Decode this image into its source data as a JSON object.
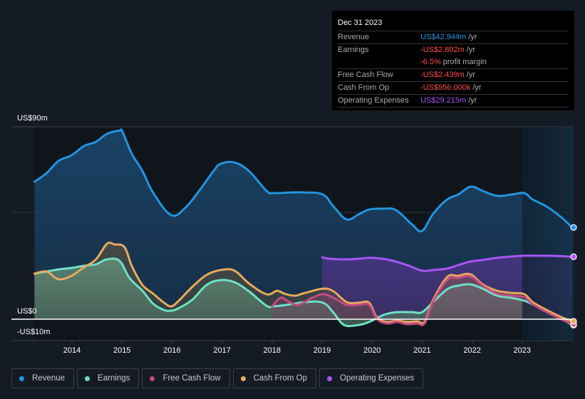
{
  "tooltip": {
    "date": "Dec 31 2023",
    "rows": [
      {
        "label": "Revenue",
        "value": "US$42.944m",
        "unit": "/yr",
        "color": "#2394df"
      },
      {
        "label": "Earnings",
        "value": "-US$2.802m",
        "unit": "/yr",
        "color": "#ff4d4d"
      },
      {
        "label": "",
        "value": "-6.5%",
        "unit": "profit margin",
        "color": "#ff4d4d"
      },
      {
        "label": "Free Cash Flow",
        "value": "-US$2.439m",
        "unit": "/yr",
        "color": "#ff4d4d"
      },
      {
        "label": "Cash From Op",
        "value": "-US$956.000k",
        "unit": "/yr",
        "color": "#ff4d4d"
      },
      {
        "label": "Operating Expenses",
        "value": "US$29.215m",
        "unit": "/yr",
        "color": "#a855f7"
      }
    ]
  },
  "legend": [
    {
      "label": "Revenue",
      "color": "#2394df"
    },
    {
      "label": "Earnings",
      "color": "#6ce0c8"
    },
    {
      "label": "Free Cash Flow",
      "color": "#c74a84"
    },
    {
      "label": "Cash From Op",
      "color": "#e8a95c"
    },
    {
      "label": "Operating Expenses",
      "color": "#a855f7"
    }
  ],
  "chart_data": {
    "type": "area",
    "title": "",
    "xlabel": "",
    "ylabel": "",
    "y_tick_labels": [
      "US$90m",
      "US$0",
      "-US$10m"
    ],
    "ylim": [
      -10,
      90
    ],
    "x_ticks": [
      2014,
      2015,
      2016,
      2017,
      2018,
      2019,
      2020,
      2021,
      2022,
      2023
    ],
    "xlim": [
      2013.25,
      2024.0
    ],
    "forecast_start": 2023.0,
    "grid": true,
    "legend_position": "bottom-left",
    "series": [
      {
        "name": "Revenue",
        "color": "#2394df",
        "x": [
          2013.25,
          2013.49,
          2013.73,
          2013.99,
          2014.24,
          2014.48,
          2014.7,
          2014.95,
          2015.01,
          2015.19,
          2015.41,
          2015.62,
          2015.98,
          2016.26,
          2016.54,
          2016.83,
          2016.97,
          2017.25,
          2017.54,
          2017.89,
          2018.03,
          2018.38,
          2018.66,
          2019.02,
          2019.23,
          2019.49,
          2019.73,
          2019.94,
          2020.23,
          2020.48,
          2020.8,
          2021.0,
          2021.22,
          2021.5,
          2021.72,
          2021.97,
          2022.21,
          2022.5,
          2022.78,
          2023.04,
          2023.21,
          2023.49,
          2023.78,
          2024.0
        ],
        "values": [
          64.3,
          68.3,
          74.0,
          76.7,
          81.0,
          83.0,
          86.7,
          88.3,
          87.7,
          77.7,
          69.3,
          59.3,
          48.7,
          52.0,
          60.0,
          69.3,
          72.7,
          73.3,
          69.3,
          60.0,
          59.0,
          59.3,
          59.3,
          58.3,
          52.7,
          46.7,
          49.0,
          51.3,
          51.7,
          51.0,
          44.3,
          41.3,
          49.3,
          56.0,
          58.3,
          62.0,
          60.0,
          57.7,
          58.3,
          59.0,
          56.0,
          52.7,
          47.7,
          42.9
        ]
      },
      {
        "name": "Earnings",
        "color": "#6ce0c8",
        "x": [
          2013.25,
          2013.49,
          2013.73,
          2013.99,
          2014.24,
          2014.48,
          2014.7,
          2014.95,
          2015.15,
          2015.41,
          2015.62,
          2015.84,
          2015.98,
          2016.12,
          2016.4,
          2016.69,
          2016.97,
          2017.25,
          2017.54,
          2017.89,
          2018.03,
          2018.38,
          2018.66,
          2019.02,
          2019.23,
          2019.44,
          2019.73,
          2019.94,
          2020.23,
          2020.48,
          2020.8,
          2021.0,
          2021.22,
          2021.5,
          2021.72,
          2021.97,
          2022.21,
          2022.5,
          2022.78,
          2023.04,
          2023.21,
          2023.49,
          2023.78,
          2024.0
        ],
        "values": [
          21.3,
          22.3,
          23.3,
          24.0,
          25.0,
          25.7,
          28.0,
          27.3,
          19.3,
          13.3,
          7.3,
          4.3,
          4.0,
          5.0,
          9.0,
          16.0,
          18.3,
          17.3,
          13.0,
          6.3,
          6.0,
          7.0,
          8.0,
          7.7,
          3.0,
          -2.7,
          -2.7,
          -1.3,
          2.0,
          3.3,
          3.3,
          3.3,
          8.0,
          14.0,
          15.7,
          16.3,
          14.3,
          11.0,
          10.0,
          8.7,
          7.0,
          4.0,
          0.3,
          -2.8
        ]
      },
      {
        "name": "Free Cash Flow",
        "color": "#c74a84",
        "x": [
          2018.0,
          2018.17,
          2018.31,
          2018.52,
          2018.8,
          2019.02,
          2019.23,
          2019.49,
          2019.73,
          2019.94,
          2020.1,
          2020.3,
          2020.5,
          2020.7,
          2020.9,
          2021.05,
          2021.22,
          2021.5,
          2021.72,
          2021.97,
          2022.21,
          2022.5,
          2022.78,
          2023.04,
          2023.21,
          2023.49,
          2023.78,
          2024.0
        ],
        "values": [
          6.0,
          10.0,
          8.5,
          6.7,
          10.0,
          11.7,
          10.0,
          6.7,
          6.7,
          6.7,
          0.0,
          -2.0,
          -1.3,
          -2.3,
          -2.0,
          -2.0,
          8.0,
          18.3,
          19.3,
          20.0,
          15.7,
          12.0,
          11.0,
          10.3,
          7.0,
          3.3,
          0.0,
          -2.4
        ]
      },
      {
        "name": "Cash From Op",
        "color": "#e8a95c",
        "x": [
          2013.25,
          2013.49,
          2013.73,
          2013.99,
          2014.24,
          2014.48,
          2014.7,
          2014.85,
          2015.05,
          2015.2,
          2015.41,
          2015.62,
          2015.84,
          2015.98,
          2016.12,
          2016.4,
          2016.69,
          2016.97,
          2017.25,
          2017.54,
          2017.89,
          2018.1,
          2018.24,
          2018.45,
          2018.66,
          2019.02,
          2019.23,
          2019.49,
          2019.73,
          2019.94,
          2020.1,
          2020.3,
          2020.5,
          2020.7,
          2020.9,
          2021.05,
          2021.22,
          2021.5,
          2021.72,
          2021.97,
          2022.21,
          2022.5,
          2022.78,
          2023.04,
          2023.21,
          2023.49,
          2023.78,
          2024.0
        ],
        "values": [
          21.3,
          22.3,
          18.7,
          20.3,
          24.3,
          28.0,
          35.3,
          35.0,
          33.7,
          24.7,
          16.0,
          12.0,
          7.7,
          6.0,
          8.3,
          15.0,
          20.7,
          23.0,
          22.7,
          16.7,
          11.7,
          13.3,
          12.0,
          11.0,
          12.3,
          14.3,
          13.0,
          8.0,
          7.7,
          7.7,
          0.7,
          -1.3,
          -0.7,
          -1.3,
          -1.0,
          -1.3,
          9.0,
          19.7,
          20.3,
          21.0,
          16.3,
          13.3,
          12.3,
          11.7,
          8.0,
          4.3,
          1.0,
          -1.0
        ]
      },
      {
        "name": "Operating Expenses",
        "color": "#a855f7",
        "x": [
          2019.0,
          2019.15,
          2019.49,
          2019.73,
          2020.0,
          2020.35,
          2020.7,
          2021.0,
          2021.22,
          2021.5,
          2021.72,
          2021.97,
          2022.21,
          2022.5,
          2022.78,
          2023.04,
          2023.21,
          2023.49,
          2023.78,
          2024.0
        ],
        "values": [
          29.0,
          28.3,
          28.0,
          28.3,
          28.7,
          27.7,
          25.3,
          22.7,
          23.0,
          23.7,
          25.3,
          27.0,
          27.7,
          28.7,
          29.3,
          29.7,
          29.7,
          29.7,
          29.5,
          29.2
        ]
      }
    ]
  }
}
